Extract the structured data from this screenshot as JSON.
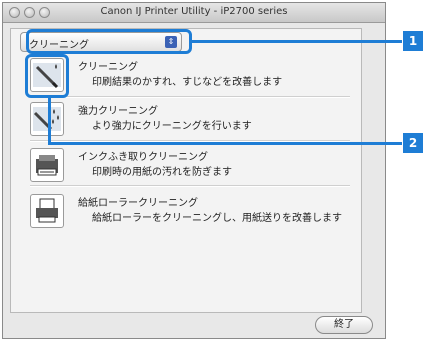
{
  "window": {
    "title": "Canon IJ Printer Utility - iP2700 series"
  },
  "popup": {
    "selected": "クリーニング"
  },
  "items": [
    {
      "name": "クリーニング",
      "desc": "印刷結果のかすれ、すじなどを改善します",
      "icon": "cleaning-icon"
    },
    {
      "name": "強力クリーニング",
      "desc": "より強力にクリーニングを行います",
      "icon": "deep-cleaning-icon"
    },
    {
      "name": "インクふき取りクリーニング",
      "desc": "印刷時の用紙の汚れを防ぎます",
      "icon": "bottom-plate-cleaning-icon"
    },
    {
      "name": "給紙ローラークリーニング",
      "desc": "給紙ローラーをクリーニングし、用紙送りを改善します",
      "icon": "roller-cleaning-icon"
    }
  ],
  "buttons": {
    "finish": "終了"
  },
  "callouts": [
    "1",
    "2"
  ],
  "colors": {
    "highlight": "#1e7dd5"
  }
}
